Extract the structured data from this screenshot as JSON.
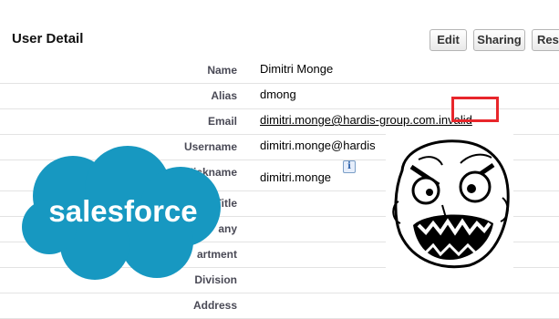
{
  "header": {
    "title": "User Detail",
    "buttons": {
      "edit": "Edit",
      "sharing": "Sharing",
      "reset": "Rese"
    }
  },
  "fields": [
    {
      "label": "Name",
      "value": "Dimitri Monge"
    },
    {
      "label": "Alias",
      "value": "dmong"
    },
    {
      "label": "Email",
      "value": "dimitri.monge@hardis-group.com.invalid"
    },
    {
      "label": "Username",
      "value": "dimitri.monge@hardis"
    },
    {
      "label": "Nickname",
      "value": "dimitri.monge"
    },
    {
      "label": "Title",
      "value": ""
    },
    {
      "label": "any",
      "value": ""
    },
    {
      "label": "artment",
      "value": ""
    },
    {
      "label": "Division",
      "value": ""
    },
    {
      "label": "Address",
      "value": ""
    }
  ],
  "logo": {
    "text": "salesforce",
    "color": "#1798c1"
  },
  "colors": {
    "highlight": "#e8262b",
    "label": "#4a4a56"
  },
  "icons": {
    "info": "i"
  }
}
